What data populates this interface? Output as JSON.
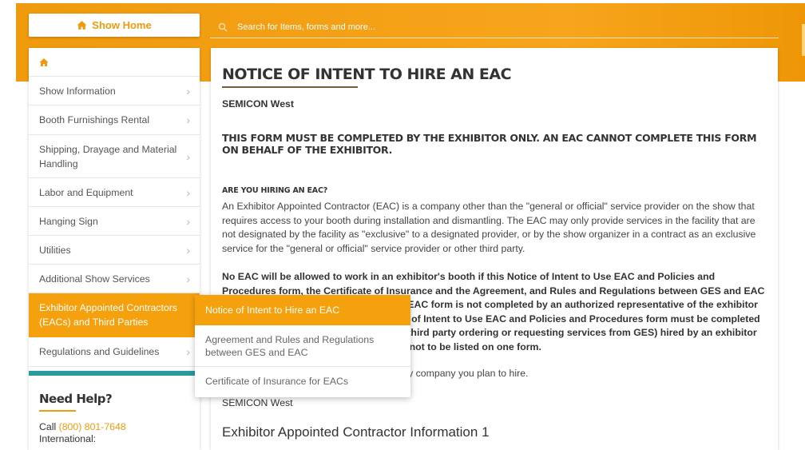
{
  "header": {
    "show_home_label": "Show Home",
    "search_placeholder": "Search for Items, forms and more..."
  },
  "sidebar": {
    "items": [
      {
        "label": "Show Information"
      },
      {
        "label": "Booth Furnishings Rental"
      },
      {
        "label": "Shipping, Drayage and Material Handling"
      },
      {
        "label": "Labor and Equipment"
      },
      {
        "label": "Hanging Sign"
      },
      {
        "label": "Utilities"
      },
      {
        "label": "Additional Show Services"
      },
      {
        "label": "Exhibitor Appointed Contractors (EACs) and Third Parties",
        "active": true
      },
      {
        "label": "Regulations and Guidelines"
      }
    ]
  },
  "help": {
    "title": "Need Help?",
    "call_label": "Call",
    "phone": "(800) 801-7648",
    "international_label": "International:"
  },
  "submenu": {
    "items": [
      {
        "label": "Notice of Intent to Hire an EAC",
        "active": true
      },
      {
        "label": "Agreement and Rules and Regulations between GES and EAC"
      },
      {
        "label": "Certificate of Insurance for EACs"
      }
    ]
  },
  "main": {
    "title": "NOTICE OF INTENT TO HIRE AN EAC",
    "show_name": "SEMICON West",
    "warning": "THIS FORM MUST BE COMPLETED BY THE EXHIBITOR ONLY. AN EAC CANNOT COMPLETE THIS FORM ON BEHALF OF THE EXHIBITOR.",
    "sub_heading": "ARE YOU HIRING AN EAC?",
    "paragraph": "An Exhibitor Appointed Contractor (EAC) is a company other than the \"general or official\" service provider on the show that requires access to your booth during installation and dismantling. The EAC may only provide services in the facility that are not designated by the facility as \"exclusive\" to a designated provider, or by the show organizer in a contract as an exclusive service for the \"general or official\" service provider or other third party.",
    "bold_paragraph": "No EAC will be allowed to work in an exhibitor's booth if this Notice of Intent to Use EAC and Policies and Procedures form, the Certificate of Insurance and the Agreement, and Rules and Regulations between GES and EAC are not on file with GES. If GES and the EAC form is not completed by an authorized representative of the exhibitor prior to the start of move-in. This Notice of Intent to Use EAC and Policies and Procedures form must be completed for any third party (as well as any other third party ordering or requesting services from GES) hired by an exhibitor for the above show. Multiple booths are not to be listed on one form.",
    "instruction": "Complete one form for each EAC/third party company you plan to hire.",
    "show_name_2": "SEMICON West",
    "section_heading": "Exhibitor Appointed Contractor Information 1"
  },
  "colors": {
    "accent": "#f5a00d",
    "teal": "#2a9b9d",
    "text": "#333333"
  }
}
